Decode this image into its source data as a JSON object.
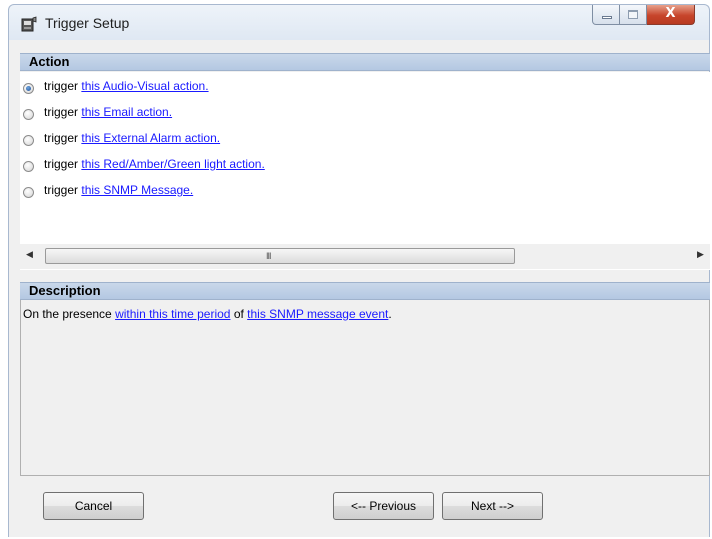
{
  "window": {
    "title": "Trigger Setup",
    "controls": {
      "minimize": "",
      "maximize": "",
      "close": "X"
    }
  },
  "action": {
    "header": "Action",
    "options": [
      {
        "prefix": "trigger",
        "link": "this Audio-Visual action.",
        "checked": true
      },
      {
        "prefix": "trigger",
        "link": "this Email action.",
        "checked": false
      },
      {
        "prefix": "trigger",
        "link": "this External Alarm action.",
        "checked": false
      },
      {
        "prefix": "trigger",
        "link": "this Red/Amber/Green light action.",
        "checked": false
      },
      {
        "prefix": "trigger",
        "link": "this SNMP Message.",
        "checked": false
      }
    ],
    "scrollbar": {
      "left": "◀",
      "right": "▶",
      "grip": "III"
    }
  },
  "description": {
    "header": "Description",
    "text_start": "On the presence",
    "link1": "within this time period",
    "text_mid": "of",
    "link2": "this SNMP message event",
    "text_end": "."
  },
  "buttons": {
    "cancel": "Cancel",
    "previous": "<-- Previous",
    "next": "Next -->"
  },
  "colors": {
    "link": "#1a1aff",
    "section_header": "#c9d8ea",
    "close_button": "#c7452b"
  }
}
